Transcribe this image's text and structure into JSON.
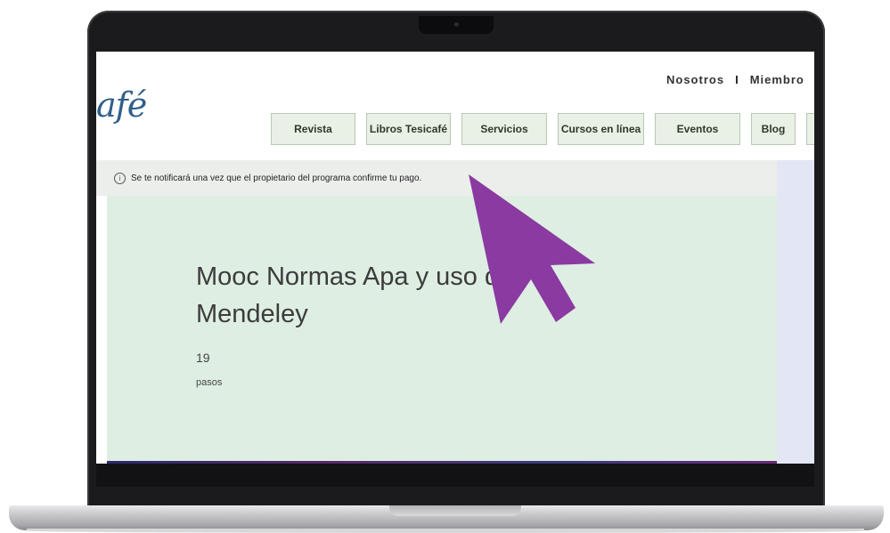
{
  "site": {
    "logo_text": "afé",
    "top_links": [
      "Nosotros",
      "Miembro"
    ],
    "separator": "I"
  },
  "nav": {
    "tabs": [
      "Revista",
      "Libros Tesicafé",
      "Servicios",
      "Cursos en línea",
      "Eventos",
      "Blog"
    ]
  },
  "notice": {
    "icon": "info-icon",
    "text": "Se te notificará una vez que el propietario del programa confirme tu pago."
  },
  "course": {
    "title": "Mooc Normas Apa y uso de Mendeley",
    "steps_count": "19",
    "steps_label": "pasos"
  },
  "colors": {
    "cursor": "#8a3aa0",
    "hero_bg": "#deeee3",
    "tab_bg": "#e9f0e6",
    "logo": "#2f5f8a"
  }
}
